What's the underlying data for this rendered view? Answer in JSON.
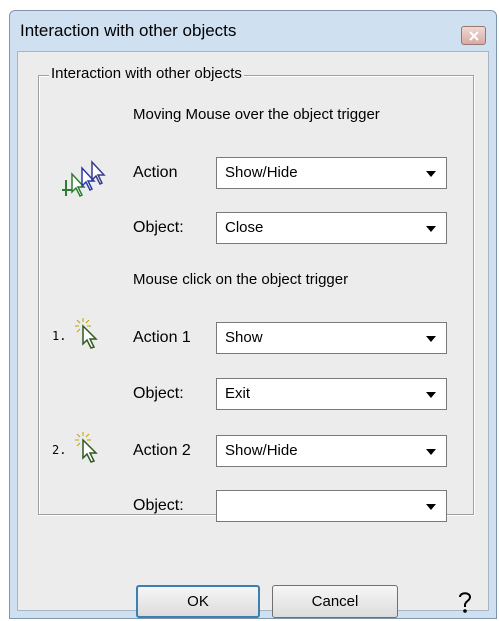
{
  "window": {
    "title": "Interaction with other objects"
  },
  "group": {
    "label": "Interaction with other objects",
    "mouse_over": {
      "heading": "Moving Mouse over the object trigger",
      "action_label": "Action",
      "action_value": "Show/Hide",
      "object_label": "Object:",
      "object_value": "Close"
    },
    "mouse_click": {
      "heading": "Mouse click on the object trigger",
      "trigger1": {
        "number": "1.",
        "action_label": "Action 1",
        "action_value": "Show",
        "object_label": "Object:",
        "object_value": "Exit"
      },
      "trigger2": {
        "number": "2.",
        "action_label": "Action 2",
        "action_value": "Show/Hide",
        "object_label": "Object:",
        "object_value": ""
      }
    }
  },
  "buttons": {
    "ok": "OK",
    "cancel": "Cancel"
  },
  "icons": {
    "close": "close-icon",
    "mouse_over": "mouse-trail-icon",
    "mouse_click": "mouse-click-icon",
    "help": "help-icon",
    "dropdown": "chevron-down-icon"
  }
}
